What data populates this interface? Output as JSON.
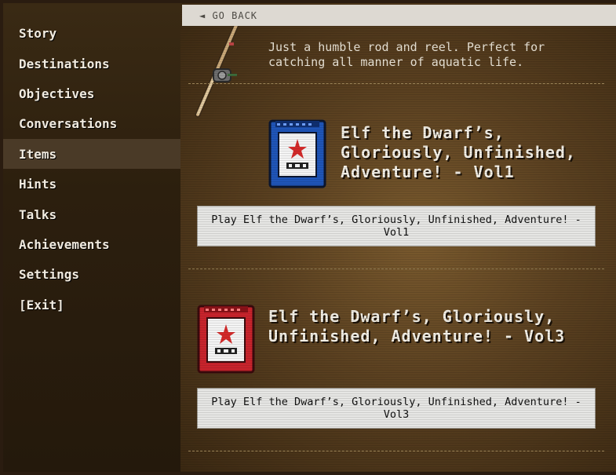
{
  "sidebar": {
    "items": [
      {
        "label": "Story"
      },
      {
        "label": "Destinations"
      },
      {
        "label": "Objectives"
      },
      {
        "label": "Conversations"
      },
      {
        "label": "Items",
        "active": true
      },
      {
        "label": "Hints"
      },
      {
        "label": "Talks"
      },
      {
        "label": "Achievements"
      },
      {
        "label": "Settings"
      },
      {
        "label": "[Exit]"
      }
    ]
  },
  "topbar": {
    "go_back": "◄ GO BACK"
  },
  "items_list": {
    "rod": {
      "description": "Just a humble rod and reel. Perfect for catching all manner of aquatic life.",
      "icon": "fishing-rod-icon"
    },
    "vol1": {
      "title": "Elf the Dwarf’s, Gloriously, Unfinished, Adventure! - Vol1",
      "button": "Play Elf the Dwarf’s, Gloriously, Unfinished, Adventure! - Vol1",
      "icon": "blue-cartridge-icon",
      "color": "#1f55b8"
    },
    "vol3": {
      "title": "Elf the Dwarf’s, Gloriously, Unfinished, Adventure! - Vol3",
      "button": "Play Elf the Dwarf’s, Gloriously, Unfinished, Adventure! - Vol3",
      "icon": "red-cartridge-icon",
      "color": "#c8242c"
    }
  },
  "colors": {
    "sidebar_active": "#4a3a27",
    "topbar": "#ddd9d2",
    "text": "#f1ebe0"
  }
}
